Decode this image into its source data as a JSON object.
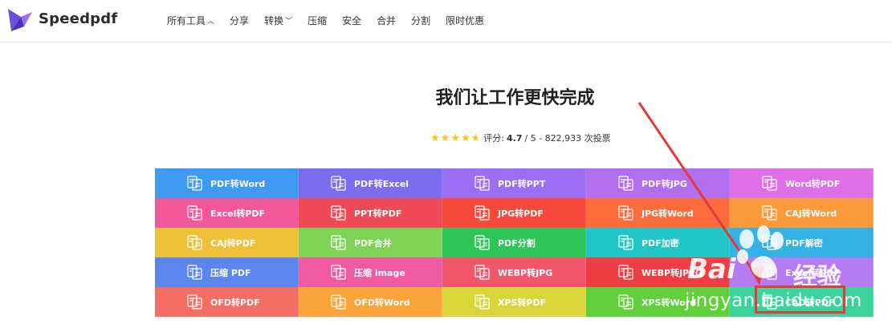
{
  "brand": {
    "name": "Speedpdf"
  },
  "nav": [
    {
      "label": "所有工具",
      "chevron": "up"
    },
    {
      "label": "分享"
    },
    {
      "label": "转换",
      "chevron": "down"
    },
    {
      "label": "压缩"
    },
    {
      "label": "安全"
    },
    {
      "label": "合并"
    },
    {
      "label": "分割"
    },
    {
      "label": "限时优惠"
    }
  ],
  "hero": {
    "title": "我们让工作更快完成",
    "rating_prefix": "评分:",
    "rating_value": "4.7",
    "rating_suffix": "/ 5 - 822,933 次投票",
    "stars": 4.7
  },
  "tools": [
    {
      "label": "PDF转Word",
      "color": "#3f9bf2",
      "icon": "document-convert-icon"
    },
    {
      "label": "PDF转Excel",
      "color": "#7b6cf0",
      "icon": "document-convert-icon"
    },
    {
      "label": "PDF转PPT",
      "color": "#9b6ef3",
      "icon": "document-convert-icon"
    },
    {
      "label": "PDF转JPG",
      "color": "#b16ff0",
      "icon": "document-convert-icon"
    },
    {
      "label": "Word转PDF",
      "color": "#de6fe8",
      "icon": "document-convert-icon"
    },
    {
      "label": "Excel转PDF",
      "color": "#f2579a",
      "icon": "document-convert-icon"
    },
    {
      "label": "PPT转PDF",
      "color": "#ef4a55",
      "icon": "document-convert-icon"
    },
    {
      "label": "JPG转PDF",
      "color": "#f74a3c",
      "icon": "document-convert-icon"
    },
    {
      "label": "JPG转Word",
      "color": "#fb6b3b",
      "icon": "document-convert-icon"
    },
    {
      "label": "CAJ转Word",
      "color": "#fb9a3a",
      "icon": "document-convert-icon"
    },
    {
      "label": "CAJ转PDF",
      "color": "#eec139",
      "icon": "document-convert-icon"
    },
    {
      "label": "PDF合并",
      "color": "#7fd356",
      "icon": "merge-icon"
    },
    {
      "label": "PDF分割",
      "color": "#2fc558",
      "icon": "split-icon"
    },
    {
      "label": "PDF加密",
      "color": "#22c6c7",
      "icon": "lock-icon"
    },
    {
      "label": "PDF解密",
      "color": "#34b2e4",
      "icon": "unlock-icon"
    },
    {
      "label": "压缩 PDF",
      "color": "#5a86ee",
      "icon": "compress-icon"
    },
    {
      "label": "压缩 image",
      "color": "#ef5aa1",
      "icon": "compress-icon"
    },
    {
      "label": "WEBP转JPG",
      "color": "#f2566b",
      "icon": "document-convert-icon"
    },
    {
      "label": "WEBP转JPEG",
      "color": "#ef3d44",
      "icon": "document-convert-icon"
    },
    {
      "label": "Excel转PDF",
      "color": "#b57cf2",
      "icon": "document-convert-icon"
    },
    {
      "label": "OFD转PDF",
      "color": "#f56e66",
      "icon": "document-convert-icon"
    },
    {
      "label": "OFD转Word",
      "color": "#fba43a",
      "icon": "document-convert-icon"
    },
    {
      "label": "XPS转PDF",
      "color": "#d8d63a",
      "icon": "document-convert-icon"
    },
    {
      "label": "XPS转Word",
      "color": "#62cf3c",
      "icon": "document-convert-icon"
    },
    {
      "label": "CAD转PDF",
      "color": "#39d39b",
      "icon": "document-convert-icon"
    }
  ],
  "watermark": {
    "brand": "Bai",
    "cn": "经验",
    "url": "jingyan.baidu.com"
  },
  "annotation": {
    "arrow_color": "#e23b3b"
  }
}
